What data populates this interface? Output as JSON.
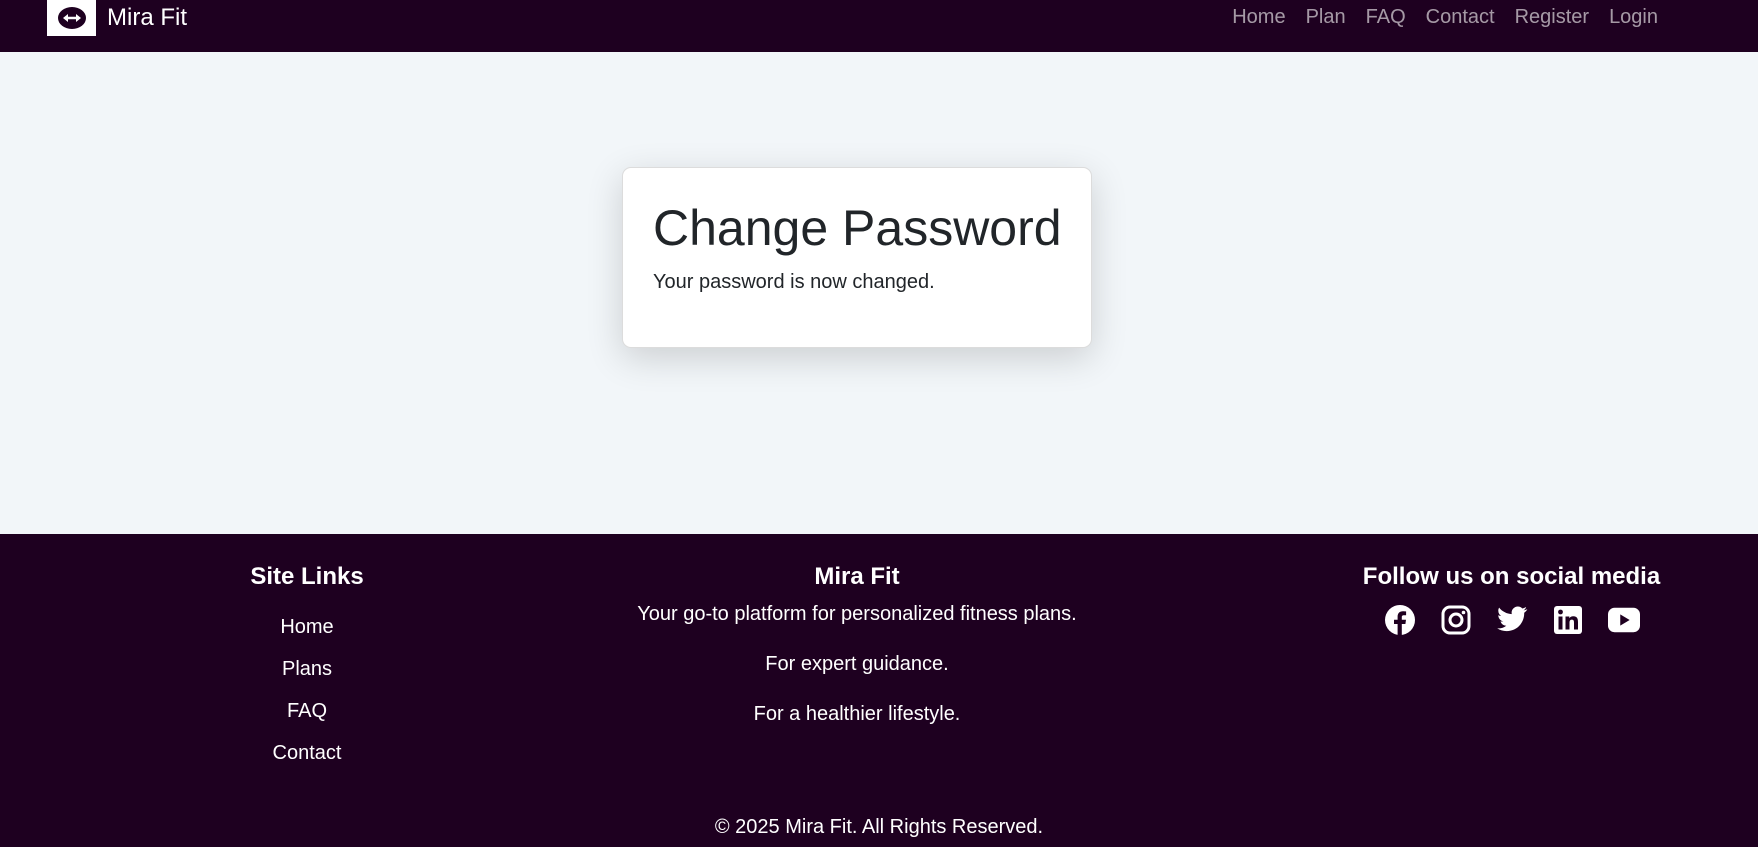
{
  "header": {
    "brand": "Mira Fit",
    "nav": [
      {
        "label": "Home"
      },
      {
        "label": "Plan"
      },
      {
        "label": "FAQ"
      },
      {
        "label": "Contact"
      },
      {
        "label": "Register"
      },
      {
        "label": "Login"
      }
    ]
  },
  "card": {
    "title": "Change Password",
    "message": "Your password is now changed."
  },
  "footer": {
    "links_title": "Site Links",
    "links": [
      {
        "label": "Home"
      },
      {
        "label": "Plans"
      },
      {
        "label": "FAQ"
      },
      {
        "label": "Contact"
      }
    ],
    "brand_title": "Mira Fit",
    "brand_lines": [
      "Your go-to platform for personalized fitness plans.",
      "For expert guidance.",
      "For a healthier lifestyle."
    ],
    "social_title": "Follow us on social media",
    "social_icons": [
      "facebook-icon",
      "instagram-icon",
      "twitter-icon",
      "linkedin-icon",
      "youtube-icon"
    ],
    "copyright": "© 2025 Mira Fit. All Rights Reserved."
  },
  "colors": {
    "nav_bg": "#1e0020",
    "page_bg": "#f2f6f9",
    "card_bg": "#ffffff"
  }
}
